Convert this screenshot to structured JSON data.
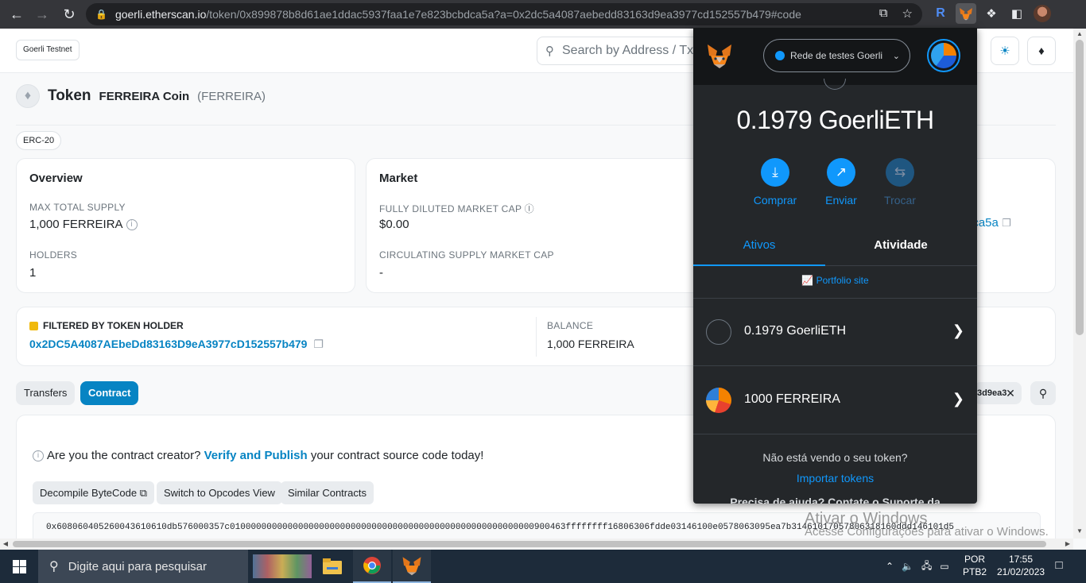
{
  "browser": {
    "url_host": "goerli.etherscan.io",
    "url_path": "/token/0x899878b8d61ae1ddac5937faa1e7e823bcbdca5a?a=0x2dc5a4087aebedd83163d9ea3977cd152557b479#code"
  },
  "etherscan": {
    "network_badge": "Goerli Testnet",
    "search_placeholder": "Search by Address / Txn",
    "token_heading": "Token",
    "token_name": "FERREIRA Coin",
    "token_symbol": "(FERREIRA)",
    "standard_badge": "ERC-20",
    "overview": {
      "title": "Overview",
      "max_supply_label": "MAX TOTAL SUPPLY",
      "max_supply_value": "1,000 FERREIRA",
      "holders_label": "HOLDERS",
      "holders_value": "1"
    },
    "market": {
      "title": "Market",
      "fdmc_label": "FULLY DILUTED MARKET CAP",
      "fdmc_value": "$0.00",
      "csmc_label": "CIRCULATING SUPPLY MARKET CAP",
      "csmc_value": "-"
    },
    "partial_contract_link": "dca5a",
    "filter": {
      "label": "FILTERED BY TOKEN HOLDER",
      "address": "0x2DC5A4087AEbeDd83163D9eA3977cD152557b479",
      "balance_label": "BALANCE",
      "balance_value": "1,000 FERREIRA"
    },
    "tabs": [
      "Transfers",
      "Contract"
    ],
    "filter_chip": "3d9ea3",
    "contract": {
      "creator_q": "Are you the contract creator?",
      "creator_link": "Verify and Publish",
      "creator_rest": "your contract source code today!",
      "btn_decompile": "Decompile ByteCode",
      "btn_opcodes": "Switch to Opcodes View",
      "btn_similar": "Similar Contracts",
      "bytecode": "0x608060405260043610610db576000357c0100000000000000000000000000000000000000000000000000000000900463ffffffff16806306fdde03146100e0578063095ea7b31461017057806318160ddd146101d5"
    }
  },
  "metamask": {
    "network": "Rede de testes Goerli",
    "balance": "0.1979 GoerliETH",
    "actions": [
      "Comprar",
      "Enviar",
      "Trocar"
    ],
    "tab_assets": "Ativos",
    "tab_activity": "Atividade",
    "portfolio": "Portfolio site",
    "assets": [
      "0.1979 GoerliETH",
      "1000 FERREIRA"
    ],
    "not_seeing": "Não está vendo o seu token?",
    "import_tokens": "Importar tokens",
    "help": "Precisa de ajuda? Contate o Suporte da"
  },
  "windows": {
    "watermark_line1": "Ativar o Windows",
    "watermark_line2": "Acesse Configurações para ativar o Windows.",
    "search_placeholder": "Digite aqui para pesquisar",
    "lang_1": "POR",
    "lang_2": "PTB2",
    "time": "17:55",
    "date": "21/02/2023"
  }
}
